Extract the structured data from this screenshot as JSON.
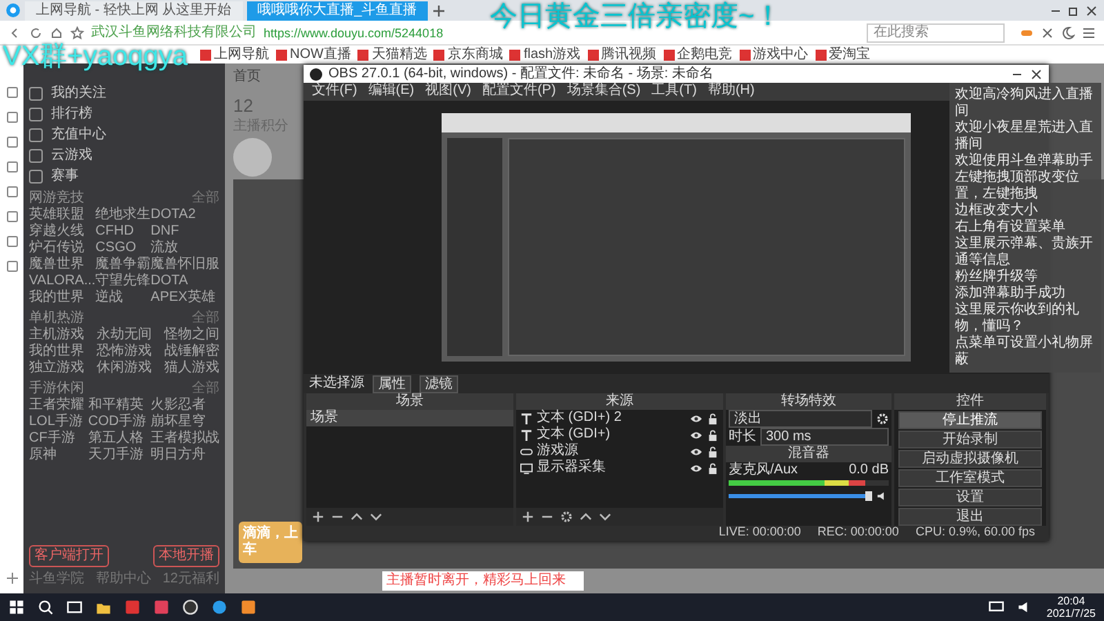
{
  "browser": {
    "tabs": [
      {
        "title": "上网导航 - 轻快上网 从这里开始",
        "selected": false
      },
      {
        "title": "哦哦哦你大直播_斗鱼直播",
        "selected": true
      }
    ],
    "site_identity": "武汉斗鱼网络科技有限公司",
    "url": "https://www.douyu.com/5244018",
    "search": {
      "placeholder": "在此搜索"
    },
    "bookmarks": [
      "上网导航",
      "NOW直播",
      "天猫精选",
      "京东商城",
      "flash游戏",
      "腾讯视频",
      "企鹅电竞",
      "游戏中心",
      "爱淘宝"
    ]
  },
  "overlay": {
    "contact": "VX群+yaoqgya",
    "banner": "今日黄金三倍亲密度~！"
  },
  "douyu": {
    "menu": [
      "我的关注",
      "排行榜",
      "充值中心",
      "云游戏"
    ],
    "events": "赛事",
    "categories": [
      {
        "title": "网游竞技",
        "more": "全部",
        "items": [
          "英雄联盟",
          "绝地求生",
          "DOTA2",
          "穿越火线",
          "CFHD",
          "DNF",
          "炉石传说",
          "CSGO",
          "流放",
          "魔兽世界",
          "魔兽争霸",
          "魔兽怀旧服",
          "VALORA...",
          "守望先锋",
          "DOTA",
          "我的世界",
          "逆战",
          "APEX英雄"
        ]
      },
      {
        "title": "单机热游",
        "more": "全部",
        "items": [
          "主机游戏",
          "永劫无间",
          "怪物之间",
          "我的世界",
          "恐怖游戏",
          "战锤解密",
          "独立游戏",
          "休闲游戏",
          "猫人游戏"
        ]
      },
      {
        "title": "手游休闲",
        "more": "全部",
        "items": [
          "王者荣耀",
          "和平精英",
          "火影忍者",
          "LOL手游",
          "COD手游",
          "崩坏星穹",
          "CF手游",
          "第五人格",
          "王者模拟战",
          "原神",
          "天刀手游",
          "明日方舟"
        ]
      }
    ],
    "buttons": [
      "客户端打开",
      "本地开播"
    ],
    "footer": [
      "斗鱼学院",
      "帮助中心",
      "12元福利"
    ],
    "nav": "首页",
    "score": {
      "value": "12",
      "label": "主播积分"
    },
    "promo": "滴滴，上车",
    "toast": "主播暂时离开，精彩马上回来"
  },
  "obs": {
    "title": "OBS 27.0.1 (64-bit, windows) - 配置文件: 未命名 - 场景: 未命名",
    "menu": [
      "文件(F)",
      "编辑(E)",
      "视图(V)",
      "配置文件(P)",
      "场景集合(S)",
      "工具(T)",
      "帮助(H)"
    ],
    "source_bar": {
      "label": "未选择源",
      "buttons": [
        "属性",
        "滤镜"
      ]
    },
    "scenes": {
      "title": "场景",
      "items": [
        {
          "name": "场景",
          "selected": true
        }
      ]
    },
    "sources": {
      "title": "来源",
      "items": [
        {
          "name": "文本 (GDI+) 2",
          "kind": "text"
        },
        {
          "name": "文本 (GDI+)",
          "kind": "text"
        },
        {
          "name": "游戏源",
          "kind": "game"
        },
        {
          "name": "显示器采集",
          "kind": "display"
        }
      ]
    },
    "transitions": {
      "title": "转场特效",
      "value": "淡出",
      "duration_label": "时长",
      "duration": "300 ms"
    },
    "mixer": {
      "title": "混音器",
      "channel": "麦克风/Aux",
      "reading": "0.0 dB",
      "meter": {
        "level": 0.85
      },
      "volume": {
        "level": 1
      }
    },
    "controls": {
      "title": "控件",
      "buttons": [
        {
          "label": "停止推流",
          "selected": true
        },
        {
          "label": "开始录制",
          "selected": false
        },
        {
          "label": "启动虚拟摄像机",
          "selected": false
        },
        {
          "label": "工作室模式",
          "selected": false
        },
        {
          "label": "设置",
          "selected": false
        },
        {
          "label": "退出",
          "selected": false
        }
      ]
    },
    "status": [
      "LIVE: 00:00:00",
      "REC: 00:00:00",
      "CPU: 0.9%, 60.00 fps"
    ]
  },
  "chat": {
    "messages": [
      "欢迎高冷狗风进入直播间",
      "欢迎小夜星星荒进入直播间",
      "欢迎使用斗鱼弹幕助手",
      "左键拖拽顶部改变位置，左键拖拽",
      "边框改变大小",
      "右上角有设置菜单",
      "这里展示弹幕、贵族开通等信息",
      "粉丝牌升级等",
      "添加弹幕助手成功",
      "这里展示你收到的礼物，懂吗？",
      "点菜单可设置小礼物屏蔽"
    ]
  },
  "taskbar": {
    "time": "20:04",
    "date": "2021/7/25"
  }
}
